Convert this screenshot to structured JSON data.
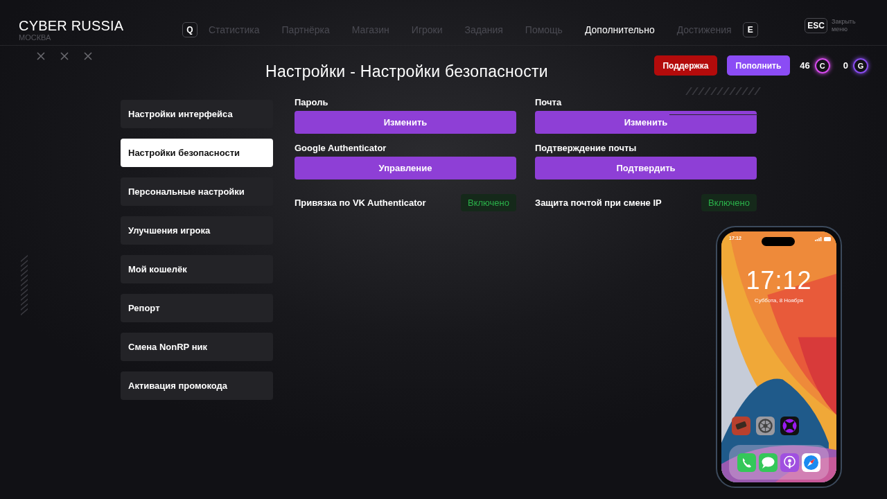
{
  "brand": {
    "name": "CYBER RUSSIA",
    "city": "МОСКВА"
  },
  "nav": {
    "prev_key": "Q",
    "next_key": "E",
    "tabs": [
      {
        "label": "Статистика",
        "selected": false
      },
      {
        "label": "Партнёрка",
        "selected": false
      },
      {
        "label": "Магазин",
        "selected": false
      },
      {
        "label": "Игроки",
        "selected": false
      },
      {
        "label": "Задания",
        "selected": false
      },
      {
        "label": "Помощь",
        "selected": false
      },
      {
        "label": "Дополнительно",
        "selected": true
      },
      {
        "label": "Достижения",
        "selected": false
      }
    ],
    "close_key": "ESC",
    "close_label": "Закрыть меню"
  },
  "title": "Настройки - Настройки безопасности",
  "actions": {
    "support": "Поддержка",
    "topup": "Пополнить"
  },
  "balances": [
    {
      "amount": "46",
      "symbol": "C",
      "color": "#d94cf0"
    },
    {
      "amount": "0",
      "symbol": "G",
      "color": "#8a4cf0"
    }
  ],
  "sidebar": {
    "items": [
      {
        "label": "Настройки интерфейса",
        "selected": false
      },
      {
        "label": "Настройки безопасности",
        "selected": true
      },
      {
        "label": "Персональные настройки",
        "selected": false
      },
      {
        "label": "Улучшения игрока",
        "selected": false
      },
      {
        "label": "Мой кошелёк",
        "selected": false
      },
      {
        "label": "Репорт",
        "selected": false
      },
      {
        "label": "Смена NonRP ник",
        "selected": false
      },
      {
        "label": "Активация промокода",
        "selected": false
      }
    ]
  },
  "settings": [
    {
      "kind": "button",
      "label": "Пароль",
      "action": "Изменить"
    },
    {
      "kind": "button",
      "label": "Почта",
      "action": "Изменить"
    },
    {
      "kind": "button",
      "label": "Google Authenticator",
      "action": "Управление"
    },
    {
      "kind": "button",
      "label": "Подтверждение почты",
      "action": "Подтвердить"
    },
    {
      "kind": "toggle",
      "label": "Привязка по VK Authenticator",
      "status": "Включено",
      "on": true
    },
    {
      "kind": "toggle",
      "label": "Защита почтой при смене IP",
      "status": "Включено",
      "on": true
    }
  ],
  "phone": {
    "status_time": "17:12",
    "time": "17:12",
    "date": "Суббота, 8 Ноября"
  }
}
